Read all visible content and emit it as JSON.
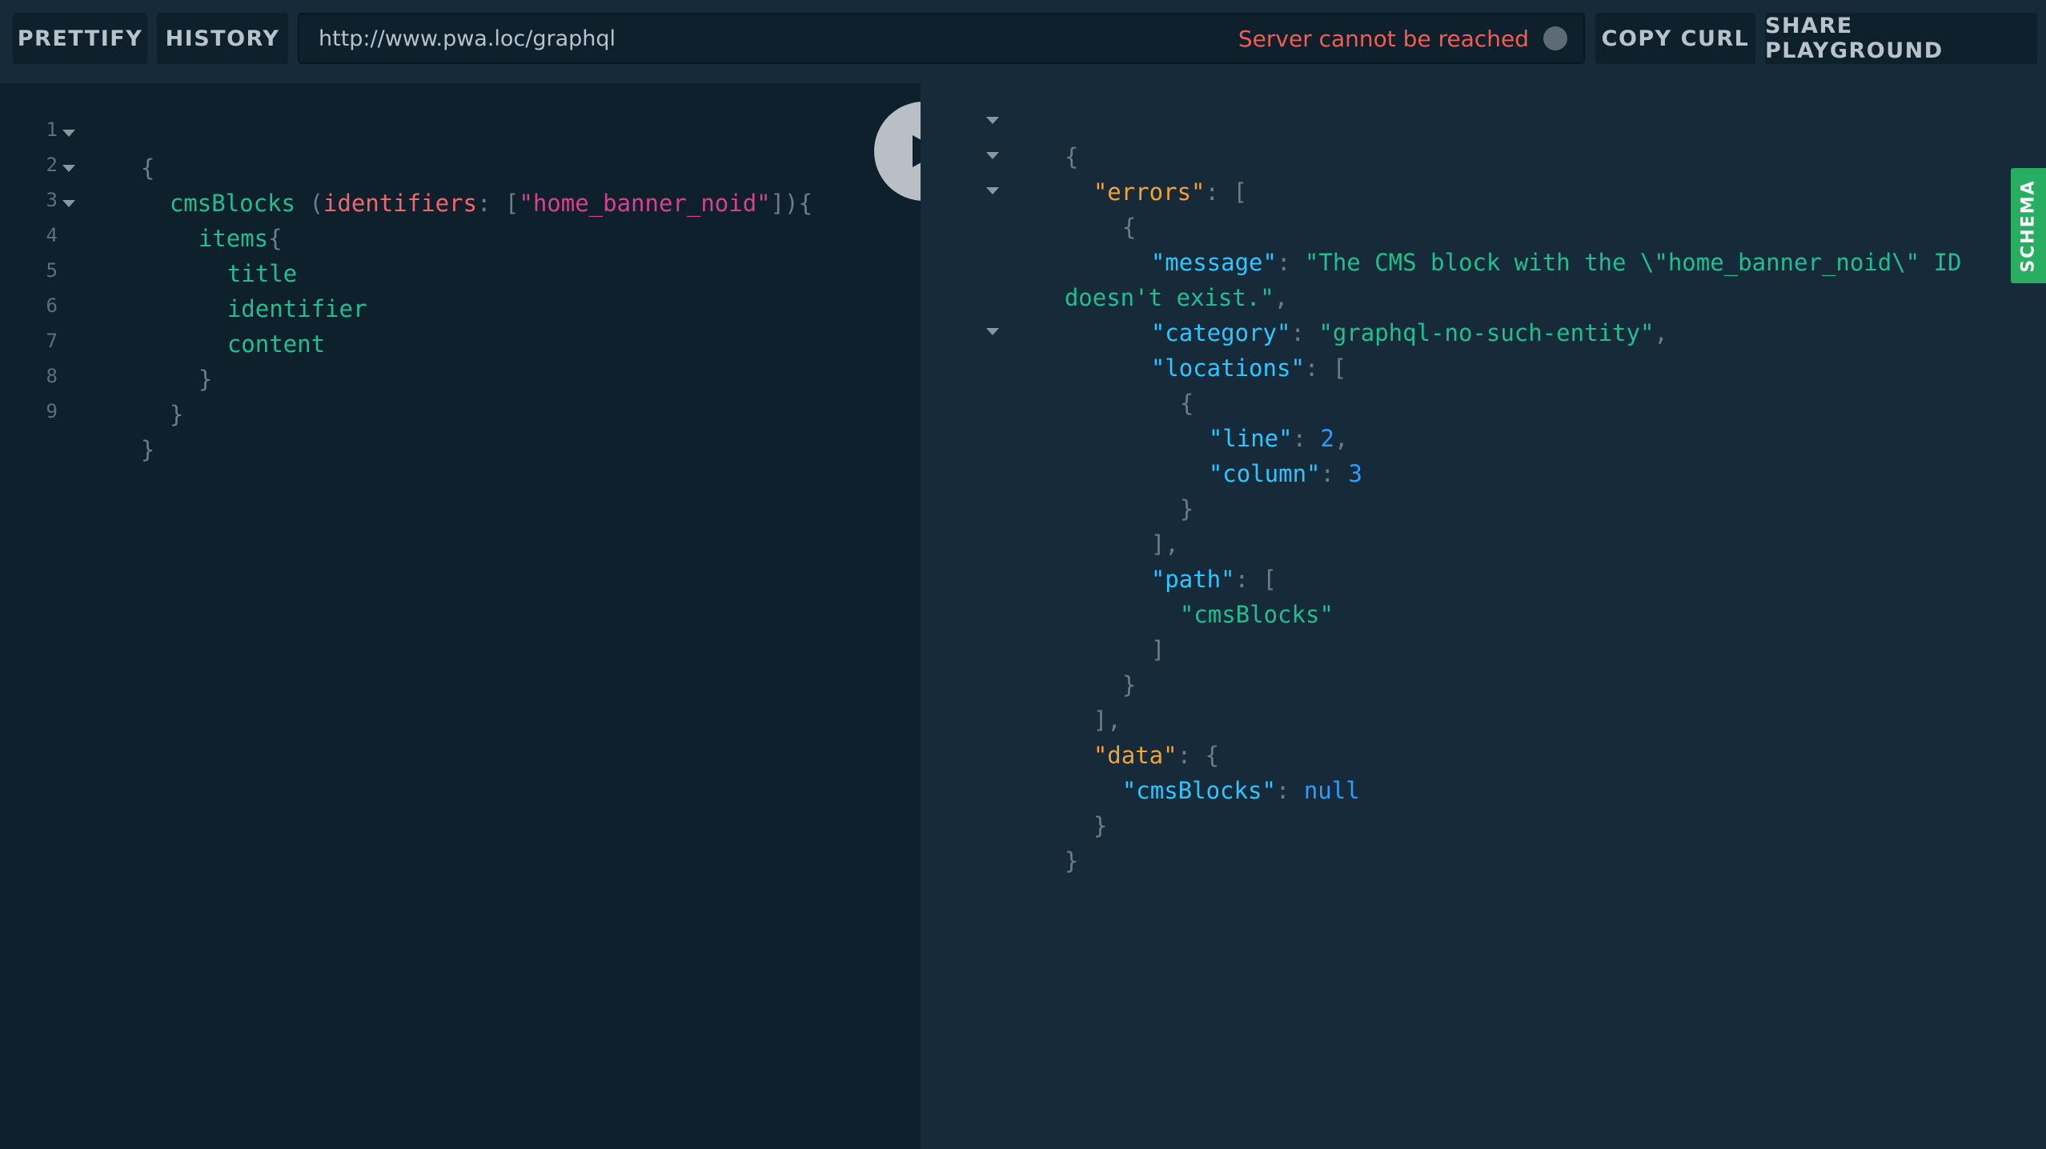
{
  "toolbar": {
    "prettify_label": "PRETTIFY",
    "history_label": "HISTORY",
    "endpoint_url": "http://www.pwa.loc/graphql",
    "server_status": "Server cannot be reached",
    "copy_curl_label": "COPY CURL",
    "share_label": "SHARE PLAYGROUND"
  },
  "schema_tab": {
    "label": "SCHEMA"
  },
  "query_editor": {
    "line_numbers": [
      "1",
      "2",
      "3",
      "4",
      "5",
      "6",
      "7",
      "8",
      "9"
    ],
    "lines": {
      "l1": {
        "open": "{"
      },
      "l2": {
        "field": "cmsBlocks",
        "space": " ",
        "paren_open": "(",
        "arg": "identifiers",
        "colon": ":",
        "bracket_open": " [",
        "string": "\"home_banner_noid\"",
        "close": "]){"
      },
      "l3": {
        "field": "items",
        "brace": "{"
      },
      "l4": {
        "field": "title"
      },
      "l5": {
        "field": "identifier"
      },
      "l6": {
        "field": "content"
      },
      "l7": {
        "close": "}"
      },
      "l8": {
        "close": "}"
      },
      "l9": {
        "close": "}"
      }
    }
  },
  "result": {
    "r1": "{",
    "errors_key": "\"errors\"",
    "errors_open": ": [",
    "obj_open": "{",
    "message_key": "\"message\"",
    "message_val_1": "\"The CMS block with the \\\"home_banner_noid\\\" ID",
    "message_val_2": "doesn't exist.\"",
    "category_key": "\"category\"",
    "category_val": "\"graphql-no-such-entity\"",
    "locations_key": "\"locations\"",
    "locations_open": ": [",
    "loc_obj_open": "{",
    "line_key": "\"line\"",
    "line_val": "2",
    "column_key": "\"column\"",
    "column_val": "3",
    "loc_obj_close": "}",
    "locations_close": "],",
    "path_key": "\"path\"",
    "path_open": ": [",
    "path_val": "\"cmsBlocks\"",
    "path_close": "]",
    "obj_close": "}",
    "errors_close": "],",
    "data_key": "\"data\"",
    "data_open": ": {",
    "cmsblocks_key": "\"cmsBlocks\"",
    "cmsblocks_val": "null",
    "data_close": "}",
    "root_close": "}"
  },
  "colors": {
    "background": "#172a3a",
    "editor_background": "#0f202d",
    "status_error": "#f25c54",
    "schema_tab": "#27ae60"
  }
}
